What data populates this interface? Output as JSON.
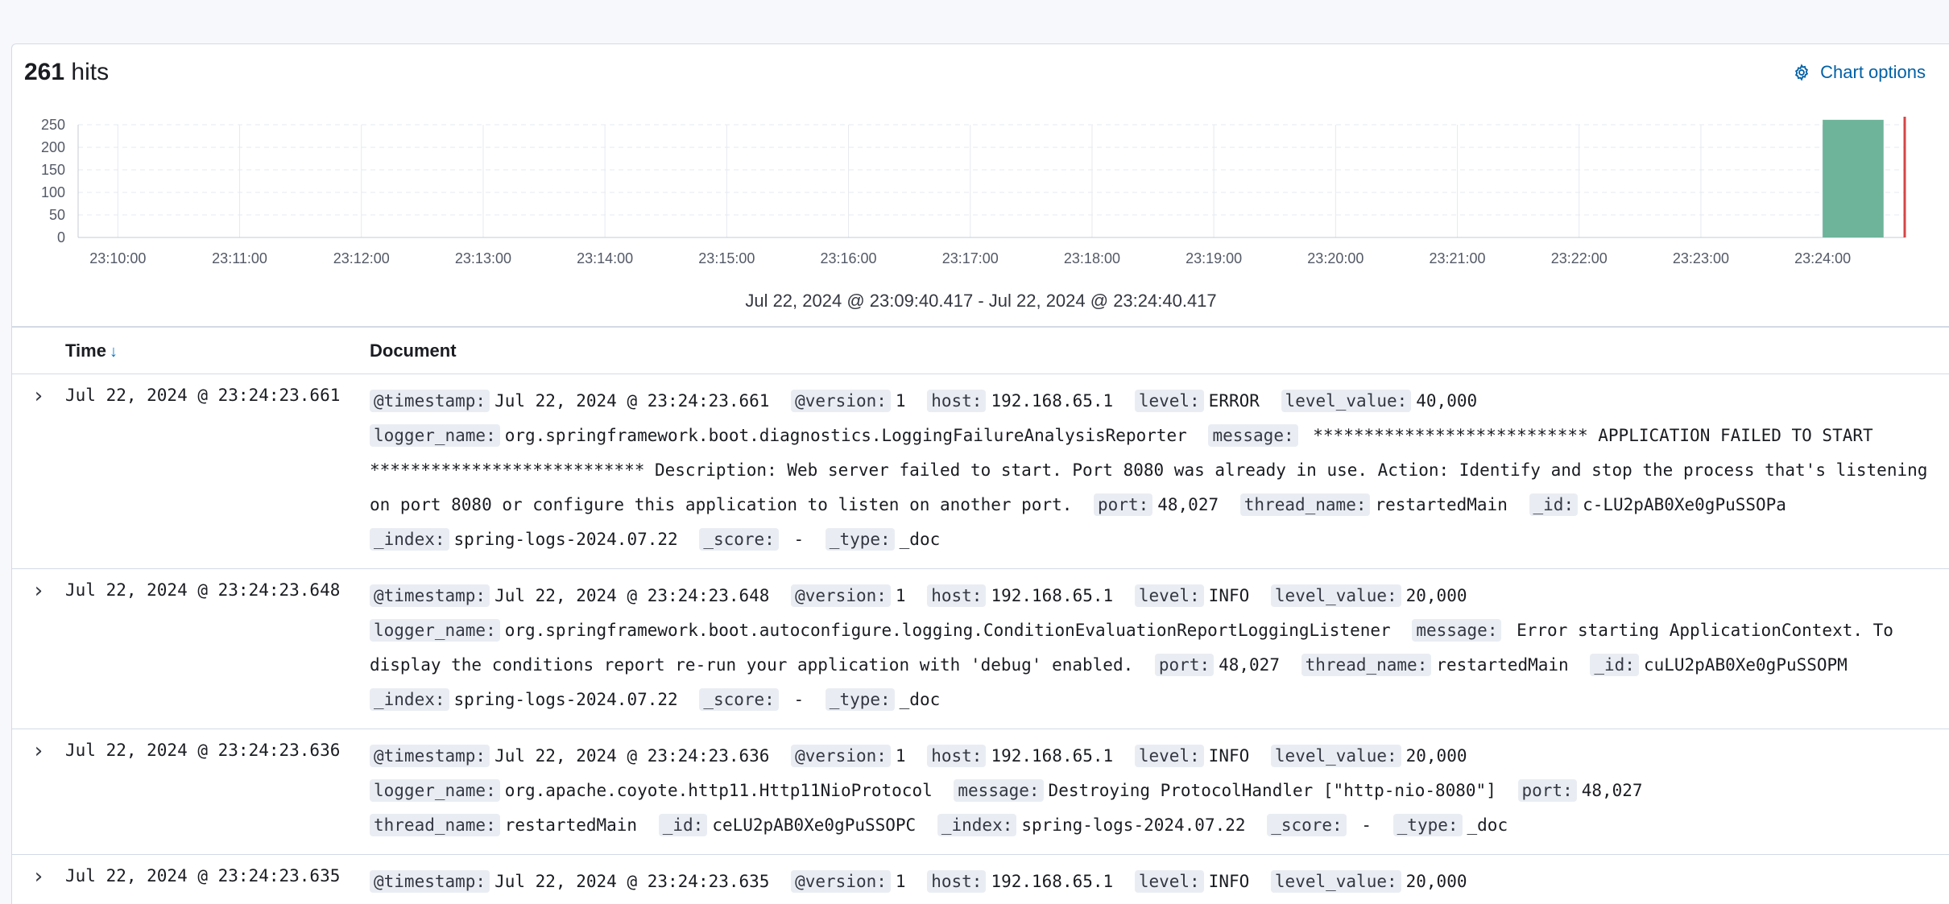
{
  "hits": {
    "count": "261",
    "label": "hits"
  },
  "chart_options_label": "Chart options",
  "chart_data": {
    "type": "bar",
    "x_ticks": [
      "23:10:00",
      "23:11:00",
      "23:12:00",
      "23:13:00",
      "23:14:00",
      "23:15:00",
      "23:16:00",
      "23:17:00",
      "23:18:00",
      "23:19:00",
      "23:20:00",
      "23:21:00",
      "23:22:00",
      "23:23:00",
      "23:24:00"
    ],
    "y_ticks": [
      0,
      50,
      100,
      150,
      200,
      250
    ],
    "ylim": [
      0,
      250
    ],
    "xlim": [
      "23:09:40.417",
      "23:24:40.417"
    ],
    "bars": [
      {
        "x_start": "23:24:00",
        "x_end": "23:24:30",
        "value": 261
      }
    ],
    "now_marker": "23:24:40.417",
    "bar_color": "#6db49a",
    "marker_color": "#d64545",
    "grid": true
  },
  "time_range": "Jul 22, 2024 @ 23:09:40.417 - Jul 22, 2024 @ 23:24:40.417",
  "columns": {
    "time": "Time",
    "document": "Document"
  },
  "rows": [
    {
      "time": "Jul 22, 2024 @ 23:24:23.661",
      "fields": [
        {
          "k": "@timestamp:",
          "v": "Jul 22, 2024 @ 23:24:23.661"
        },
        {
          "k": "@version:",
          "v": "1"
        },
        {
          "k": "host:",
          "v": "192.168.65.1"
        },
        {
          "k": "level:",
          "v": "ERROR"
        },
        {
          "k": "level_value:",
          "v": "40,000"
        },
        {
          "k": "logger_name:",
          "v": "org.springframework.boot.diagnostics.LoggingFailureAnalysisReporter"
        },
        {
          "k": "message:",
          "v": " *************************** APPLICATION FAILED TO START *************************** Description: Web server failed to start. Port 8080 was already in use. Action: Identify and stop the process that's listening on port 8080 or configure this application to listen on another port."
        },
        {
          "k": "port:",
          "v": "48,027"
        },
        {
          "k": "thread_name:",
          "v": "restartedMain"
        },
        {
          "k": "_id:",
          "v": "c-LU2pAB0Xe0gPuSSOPa"
        },
        {
          "k": "_index:",
          "v": "spring-logs-2024.07.22"
        },
        {
          "k": "_score:",
          "v": " -"
        },
        {
          "k": "_type:",
          "v": "_doc"
        }
      ]
    },
    {
      "time": "Jul 22, 2024 @ 23:24:23.648",
      "fields": [
        {
          "k": "@timestamp:",
          "v": "Jul 22, 2024 @ 23:24:23.648"
        },
        {
          "k": "@version:",
          "v": "1"
        },
        {
          "k": "host:",
          "v": "192.168.65.1"
        },
        {
          "k": "level:",
          "v": "INFO"
        },
        {
          "k": "level_value:",
          "v": "20,000"
        },
        {
          "k": "logger_name:",
          "v": "org.springframework.boot.autoconfigure.logging.ConditionEvaluationReportLoggingListener"
        },
        {
          "k": "message:",
          "v": " Error starting ApplicationContext. To display the conditions report re-run your application with 'debug' enabled."
        },
        {
          "k": "port:",
          "v": "48,027"
        },
        {
          "k": "thread_name:",
          "v": "restartedMain"
        },
        {
          "k": "_id:",
          "v": "cuLU2pAB0Xe0gPuSSOPM"
        },
        {
          "k": "_index:",
          "v": "spring-logs-2024.07.22"
        },
        {
          "k": "_score:",
          "v": " -"
        },
        {
          "k": "_type:",
          "v": "_doc"
        }
      ]
    },
    {
      "time": "Jul 22, 2024 @ 23:24:23.636",
      "fields": [
        {
          "k": "@timestamp:",
          "v": "Jul 22, 2024 @ 23:24:23.636"
        },
        {
          "k": "@version:",
          "v": "1"
        },
        {
          "k": "host:",
          "v": "192.168.65.1"
        },
        {
          "k": "level:",
          "v": "INFO"
        },
        {
          "k": "level_value:",
          "v": "20,000"
        },
        {
          "k": "logger_name:",
          "v": "org.apache.coyote.http11.Http11NioProtocol"
        },
        {
          "k": "message:",
          "v": "Destroying ProtocolHandler [\"http-nio-8080\"]"
        },
        {
          "k": "port:",
          "v": "48,027"
        },
        {
          "k": "thread_name:",
          "v": "restartedMain"
        },
        {
          "k": "_id:",
          "v": "ceLU2pAB0Xe0gPuSSOPC"
        },
        {
          "k": "_index:",
          "v": "spring-logs-2024.07.22"
        },
        {
          "k": "_score:",
          "v": " -"
        },
        {
          "k": "_type:",
          "v": "_doc"
        }
      ]
    },
    {
      "time": "Jul 22, 2024 @ 23:24:23.635",
      "fields": [
        {
          "k": "@timestamp:",
          "v": "Jul 22, 2024 @ 23:24:23.635"
        },
        {
          "k": "@version:",
          "v": "1"
        },
        {
          "k": "host:",
          "v": "192.168.65.1"
        },
        {
          "k": "level:",
          "v": "INFO"
        },
        {
          "k": "level_value:",
          "v": "20,000"
        }
      ]
    }
  ]
}
